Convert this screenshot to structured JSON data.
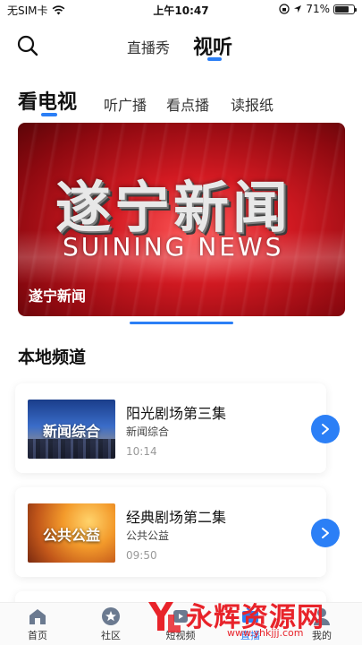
{
  "status_bar": {
    "carrier": "无SIM卡",
    "time": "上午10:47",
    "battery": "71%",
    "battery_level": 0.71
  },
  "header": {
    "tabs": [
      {
        "label": "直播秀"
      },
      {
        "label": "视听"
      }
    ],
    "active_tab": "视听"
  },
  "subtabs": [
    {
      "label": "看电视"
    },
    {
      "label": "听广播"
    },
    {
      "label": "看点播"
    },
    {
      "label": "读报纸"
    }
  ],
  "active_subtab": "看电视",
  "banner": {
    "title_cn": "遂宁新闻",
    "title_en": "SUINING NEWS",
    "caption": "遂宁新闻"
  },
  "section": {
    "title": "本地频道"
  },
  "channels": [
    {
      "thumb_label": "新闻综合",
      "title": "阳光剧场第三集",
      "channel": "新闻综合",
      "time": "10:14"
    },
    {
      "thumb_label": "公共公益",
      "title": "经典剧场第二集",
      "channel": "公共公益",
      "time": "09:50"
    }
  ],
  "bottom_nav": [
    {
      "label": "首页"
    },
    {
      "label": "社区"
    },
    {
      "label": "短视频"
    },
    {
      "label": "直播"
    },
    {
      "label": "我的"
    }
  ],
  "watermark": {
    "text": "永辉资源网",
    "url": "www.yhkjjj.com"
  },
  "colors": {
    "accent": "#2b7ff6",
    "watermark": "#e8232a"
  }
}
